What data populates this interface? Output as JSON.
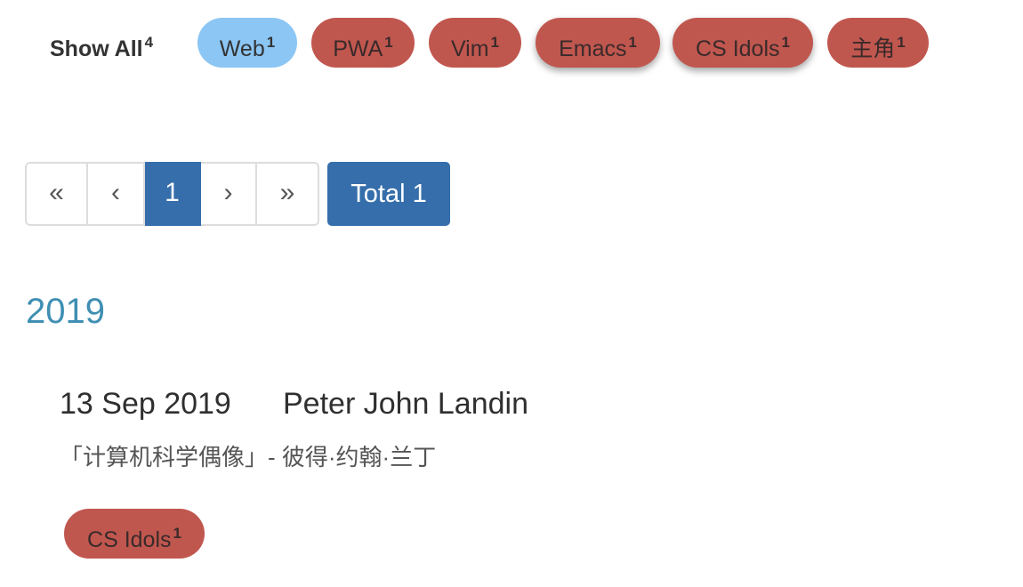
{
  "tag_filter": {
    "show_all": {
      "label": "Show All",
      "count": "4"
    },
    "tags": [
      {
        "label": "Web",
        "count": "1",
        "state": "active"
      },
      {
        "label": "PWA",
        "count": "1",
        "state": "normal"
      },
      {
        "label": "Vim",
        "count": "1",
        "state": "normal"
      },
      {
        "label": "Emacs",
        "count": "1",
        "state": "hover"
      },
      {
        "label": "CS Idols",
        "count": "1",
        "state": "hover"
      },
      {
        "label": "主角",
        "count": "1",
        "state": "normal"
      }
    ]
  },
  "pagination": {
    "first": "«",
    "prev": "‹",
    "current": "1",
    "next": "›",
    "last": "»",
    "total_label": "Total 1"
  },
  "archive": {
    "year": "2019",
    "posts": [
      {
        "date": "13 Sep 2019",
        "title": "Peter John Landin",
        "summary": "「计算机科学偶像」- 彼得·约翰·兰丁",
        "tag": {
          "label": "CS Idols",
          "count": "1"
        }
      }
    ]
  },
  "colors": {
    "tag_bg": "#c0574f",
    "tag_active_bg": "#8bc6f4",
    "pagination_active": "#356eab",
    "year_text": "#3f8fb3"
  }
}
